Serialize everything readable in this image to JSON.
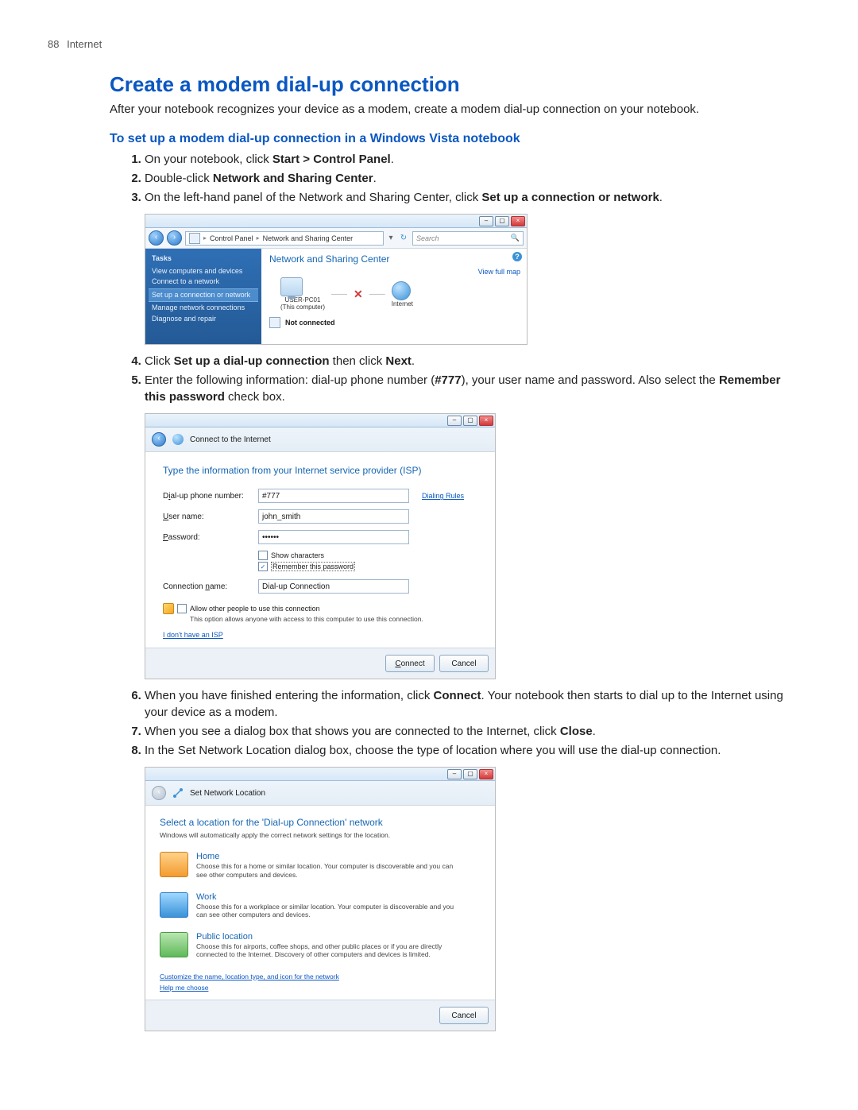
{
  "header": {
    "page": "88",
    "section": "Internet"
  },
  "content": {
    "title": "Create a modem dial-up connection",
    "intro": "After your notebook recognizes your device as a modem, create a modem dial-up connection on your notebook.",
    "subhead": "To set up a modem dial-up connection in a Windows Vista notebook",
    "s1_pre": "On your notebook, click ",
    "s1_bold": "Start > Control Panel",
    "s1_post": ".",
    "s2_pre": "Double-click ",
    "s2_bold": "Network and Sharing Center",
    "s2_post": ".",
    "s3_pre": "On the left-hand panel of the Network and Sharing Center, click ",
    "s3_bold": "Set up a connection or network",
    "s3_post": ".",
    "s4_pre": "Click ",
    "s4_b1": "Set up a dial-up connection",
    "s4_mid": " then click ",
    "s4_b2": "Next",
    "s4_post": ".",
    "s5_pre": "Enter the following information: dial-up phone number (",
    "s5_b1": "#777",
    "s5_mid": "), your user name and password. Also select the ",
    "s5_b2": "Remember this password",
    "s5_post": " check box.",
    "s6_pre": "When you have finished entering the information, click ",
    "s6_b1": "Connect",
    "s6_post": ". Your notebook then starts to dial up to the Internet using your device as a modem.",
    "s7_pre": "When you see a dialog box that shows you are connected to the Internet, click ",
    "s7_b1": "Close",
    "s7_post": ".",
    "s8": "In the Set Network Location dialog box, choose the type of location where you will use the dial-up connection."
  },
  "shot1": {
    "bc1": "Control Panel",
    "bc2": "Network and Sharing Center",
    "search": "Search",
    "tasksTitle": "Tasks",
    "t1": "View computers and devices",
    "t2": "Connect to a network",
    "t3": "Set up a connection or network",
    "t4": "Manage network connections",
    "t5": "Diagnose and repair",
    "title": "Network and Sharing Center",
    "viewmap": "View full map",
    "pc": "USER-PC01",
    "pcsub": "(This computer)",
    "internet": "Internet",
    "notconn": "Not connected"
  },
  "shot2": {
    "title": "Connect to the Internet",
    "prompt": "Type the information from your Internet service provider (ISP)",
    "lbl_phone_pre": "D",
    "lbl_phone_u": "i",
    "lbl_phone_post": "al-up phone number:",
    "val_phone": "#777",
    "dialrules": "Dialing Rules",
    "lbl_user_u": "U",
    "lbl_user_post": "ser name:",
    "val_user": "john_smith",
    "lbl_pw_u": "P",
    "lbl_pw_post": "assword:",
    "val_pw": "••••••",
    "show_u": "S",
    "show_post": "how characters",
    "rem_u": "R",
    "rem_post": "emember this password",
    "lbl_conn_pre": "Connection ",
    "lbl_conn_u": "n",
    "lbl_conn_post": "ame:",
    "val_conn": "Dial-up Connection",
    "allow_u": "A",
    "allow_post": "llow other people to use this connection",
    "allow_note": "This option allows anyone with access to this computer to use this connection.",
    "isp": "I don't have an ISP",
    "connect_u": "C",
    "connect_post": "onnect",
    "cancel": "Cancel"
  },
  "shot3": {
    "title": "Set Network Location",
    "prompt": "Select a location for the 'Dial-up Connection' network",
    "auto": "Windows will automatically apply the correct network settings for the location.",
    "home_t": "Home",
    "home_d": "Choose this for a home or similar location. Your computer is discoverable and you can see other computers and devices.",
    "work_t": "Work",
    "work_d": "Choose this for a workplace or similar location. Your computer is discoverable and you can see other computers and devices.",
    "pub_t": "Public location",
    "pub_d": "Choose this for airports, coffee shops, and other public places or if you are directly connected to the Internet. Discovery of other computers and devices is limited.",
    "link1": "Customize the name, location type, and icon for the network",
    "link2": "Help me choose",
    "cancel": "Cancel"
  }
}
